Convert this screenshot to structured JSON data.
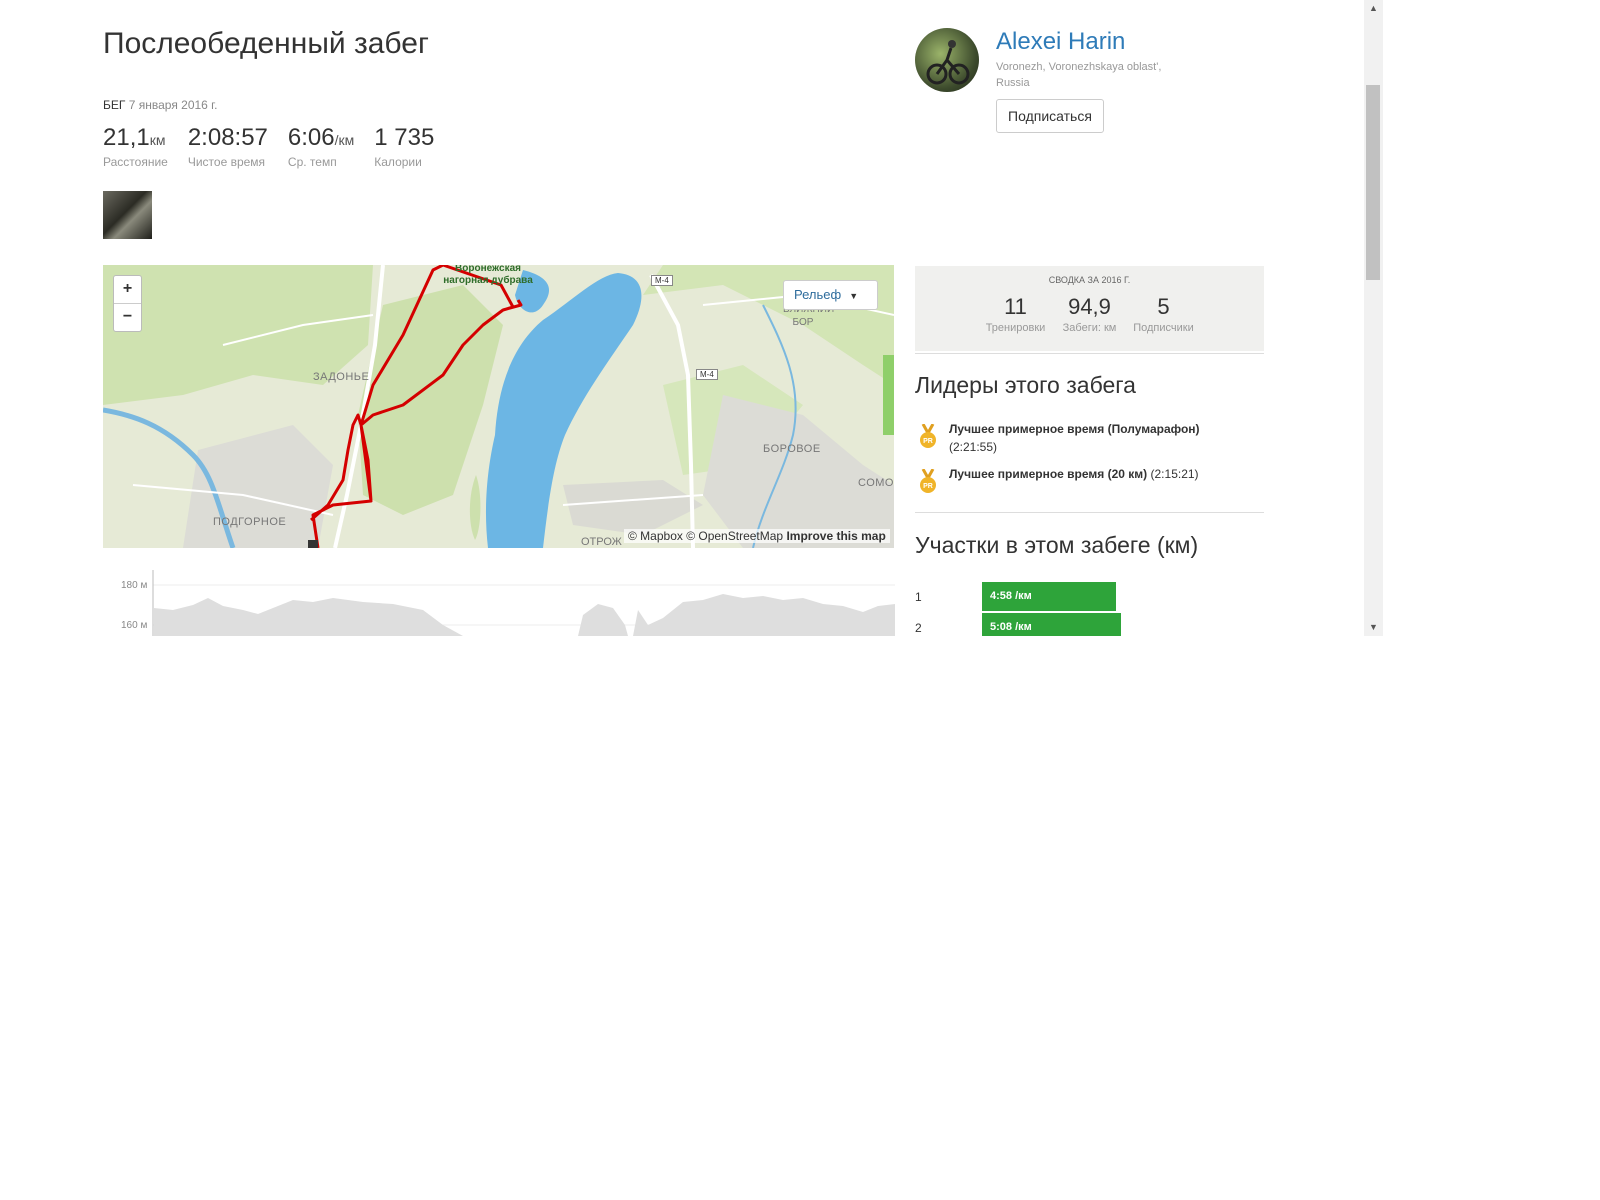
{
  "activity": {
    "title": "Послеобеденный забег",
    "type": "Бег",
    "date": "7 января 2016 г.",
    "stats": [
      {
        "value": "21,1",
        "unit": "км",
        "label": "Расстояние"
      },
      {
        "value": "2:08:57",
        "unit": "",
        "label": "Чистое время"
      },
      {
        "value": "6:06",
        "unit": "/км",
        "label": "Ср. темп"
      },
      {
        "value": "1 735",
        "unit": "",
        "label": "Калории"
      }
    ]
  },
  "map": {
    "zoom_in": "+",
    "zoom_out": "−",
    "style_button": "Рельеф",
    "labels": {
      "zadonye": "ЗАДОНЬЕ",
      "podgornoe": "ПОДГОРНОЕ",
      "borovoe": "БОРОВОЕ",
      "somovo": "СОМОВ",
      "blizhniy_bor": "БЛИЖНИЙ БОР",
      "otrozhka": "ОТРОЖ",
      "dubrava": "Воронежская нагорная дубрава",
      "road_m4_a": "M-4",
      "road_m4_b": "M-4"
    },
    "attribution": "© Mapbox © OpenStreetMap",
    "improve": "Improve this map"
  },
  "elevation": {
    "y_labels": [
      "180 м",
      "160 м"
    ]
  },
  "athlete": {
    "name": "Alexei Harin",
    "location": "Voronezh, Voronezhskaya oblast', Russia",
    "follow_button": "Подписаться"
  },
  "summary": {
    "heading": "Сводка за 2016 г.",
    "items": [
      {
        "value": "11",
        "label": "Тренировки"
      },
      {
        "value": "94,9",
        "label": "Забеги: км"
      },
      {
        "value": "5",
        "label": "Подписчики"
      }
    ]
  },
  "leaders": {
    "heading": "Лидеры этого забега",
    "items": [
      {
        "name": "Лучшее примерное время (Полумарафон)",
        "time": "(2:21:55)"
      },
      {
        "name": "Лучшее примерное время (20 км)",
        "time": "(2:15:21)"
      }
    ]
  },
  "splits": {
    "heading": "Участки в этом забеге (км)",
    "items": [
      {
        "num": "1",
        "pace": "4:58 /км"
      },
      {
        "num": "2",
        "pace": "5:08 /км"
      }
    ]
  },
  "colors": {
    "accent_link": "#2e7bb8",
    "route": "#d40000",
    "split_bar": "#2ea43a",
    "water": "#6cb6e4",
    "medal": "#f0b429"
  }
}
